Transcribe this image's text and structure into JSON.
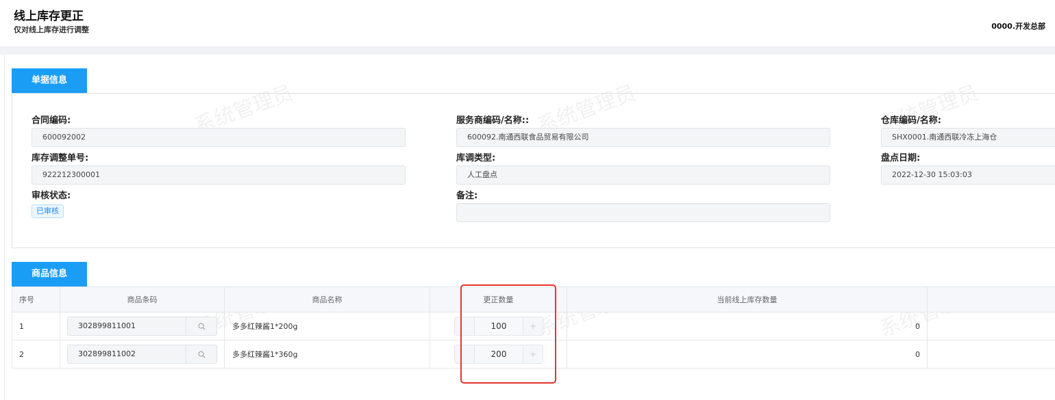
{
  "header": {
    "title": "线上库存更正",
    "subtitle": "仅对线上库存进行调整",
    "org": "0000.开发总部"
  },
  "watermark": "系统管理员",
  "doc_section": {
    "tab": "单据信息",
    "fields": {
      "contract_label": "合同编码:",
      "contract_value": "600092002",
      "adjust_no_label": "库存调整单号:",
      "adjust_no_value": "922212300001",
      "audit_label": "审核状态:",
      "audit_value": "已审核",
      "provider_label": "服务商编码/名称::",
      "provider_value": "600092.南通西联食品贸易有限公司",
      "adjust_type_label": "库调类型:",
      "adjust_type_value": "人工盘点",
      "remark_label": "备注:",
      "remark_value": "",
      "warehouse_label": "仓库编码/名称:",
      "warehouse_value": "SHX0001.南通西联冷冻上海仓",
      "check_date_label": "盘点日期:",
      "check_date_value": "2022-12-30 15:03:03"
    }
  },
  "goods_section": {
    "tab": "商品信息",
    "columns": [
      "序号",
      "商品条码",
      "商品名称",
      "更正数量",
      "当前线上库存数量"
    ],
    "rows": [
      {
        "index": "1",
        "barcode": "302899811001",
        "name": "多多红辣酱1*200g",
        "qty": "100",
        "stock": "0"
      },
      {
        "index": "2",
        "barcode": "302899811002",
        "name": "多多红辣酱1*360g",
        "qty": "200",
        "stock": "0"
      }
    ],
    "stepper_plus": "+"
  },
  "icons": {
    "barcode_search": "search-icon"
  },
  "colors": {
    "accent": "#1a9df5",
    "highlight": "#e8322c",
    "status_tag": "#1a8cff"
  }
}
